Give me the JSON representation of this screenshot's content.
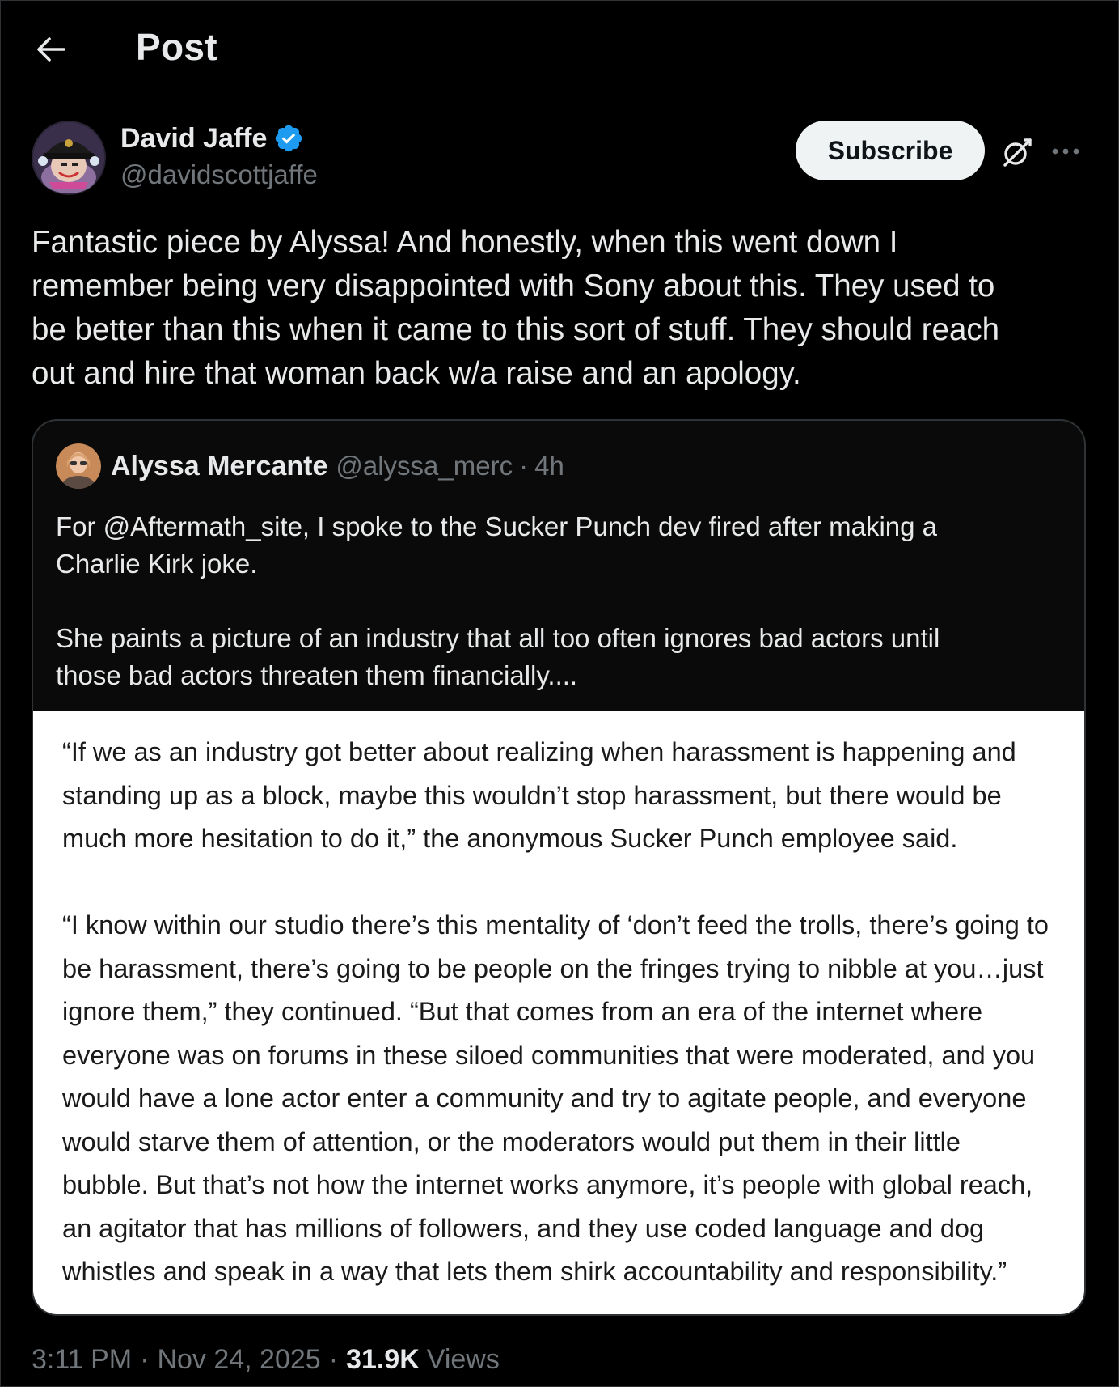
{
  "header": {
    "title": "Post"
  },
  "author": {
    "name": "David Jaffe",
    "handle": "@davidscottjaffe",
    "verified": true
  },
  "actions": {
    "subscribe_label": "Subscribe"
  },
  "tweet": {
    "text": "Fantastic piece by Alyssa! And honestly, when this went down I\nremember being very disappointed with Sony about this. They used to\nbe better than this when it came to this sort of stuff. They should reach\nout and hire that woman back w/a raise and an apology."
  },
  "quote": {
    "name": "Alyssa Mercante",
    "handle": "@alyssa_merc",
    "separator": "·",
    "time": "4h",
    "text": "For @Aftermath_site, I spoke to the Sucker Punch dev fired after making a\nCharlie Kirk joke.\n\nShe paints a picture of an industry that all too often ignores bad actors until\nthose bad actors threaten them financially....",
    "image_text": "“If we as an industry got better about realizing when harassment is happening and\nstanding up as a block, maybe this wouldn’t stop harassment, but there would be\nmuch more hesitation to do it,” the anonymous Sucker Punch employee said.\n\n“I know within our studio there’s this mentality of ‘don’t feed the trolls, there’s going to\nbe harassment, there’s going to be people on the fringes trying to nibble at you…just\nignore them,” they continued. “But that comes from an era of the internet where\neveryone was on forums in these siloed communities that were moderated, and you\nwould have a lone actor enter a community and try to agitate people, and everyone\nwould starve them of attention, or the moderators would put them in their little\nbubble. But that’s not how the internet works anymore, it’s people with global reach,\nan agitator that has millions of followers, and they use coded language and dog\nwhistles and speak in a way that lets them shirk accountability and responsibility.”"
  },
  "meta": {
    "time": "3:11 PM",
    "separator": "·",
    "date": "Nov 24, 2025",
    "views_count": "31.9K",
    "views_label": "Views"
  },
  "colors": {
    "background": "#000000",
    "text_primary": "#e7e9ea",
    "text_secondary": "#71767b",
    "verified_blue": "#1d9bf0",
    "border": "#2f3336",
    "subscribe_bg": "#eff3f4"
  },
  "icons": {
    "back": "back-arrow-icon",
    "verified": "verified-badge-icon",
    "grok": "grok-icon",
    "more": "more-dots-icon"
  }
}
